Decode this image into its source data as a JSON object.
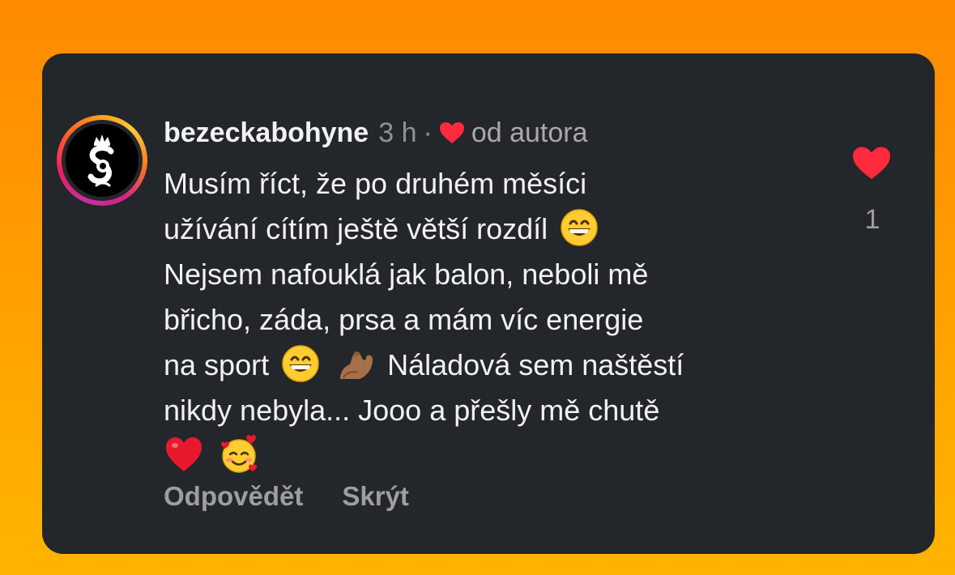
{
  "comment": {
    "username": "bezeckabohyne",
    "time": "3 h",
    "separator": "·",
    "author_like_label": "od autora",
    "lines": [
      "Musím říct, že po druhém měsíci",
      "užívání cítím ještě větší rozdíl",
      "Nejsem nafouklá jak balon, neboli mě",
      "břicho, záda, prsa a mám víc energie",
      "na sport",
      "Náladová sem naštěstí",
      "nikdy nebyla... Jooo a přešly mě chutě"
    ],
    "emojis": [
      "grinning-face-with-smiling-eyes",
      "flexed-biceps",
      "red-heart",
      "smiling-face-with-hearts"
    ],
    "actions": {
      "reply": "Odpovědět",
      "hide": "Skrýt"
    },
    "like_count": "1"
  },
  "colors": {
    "card_background": "#23262b",
    "heart_red": "#ff2a3d",
    "text_primary": "#f2f2f2",
    "text_secondary": "#9c9ea2"
  }
}
